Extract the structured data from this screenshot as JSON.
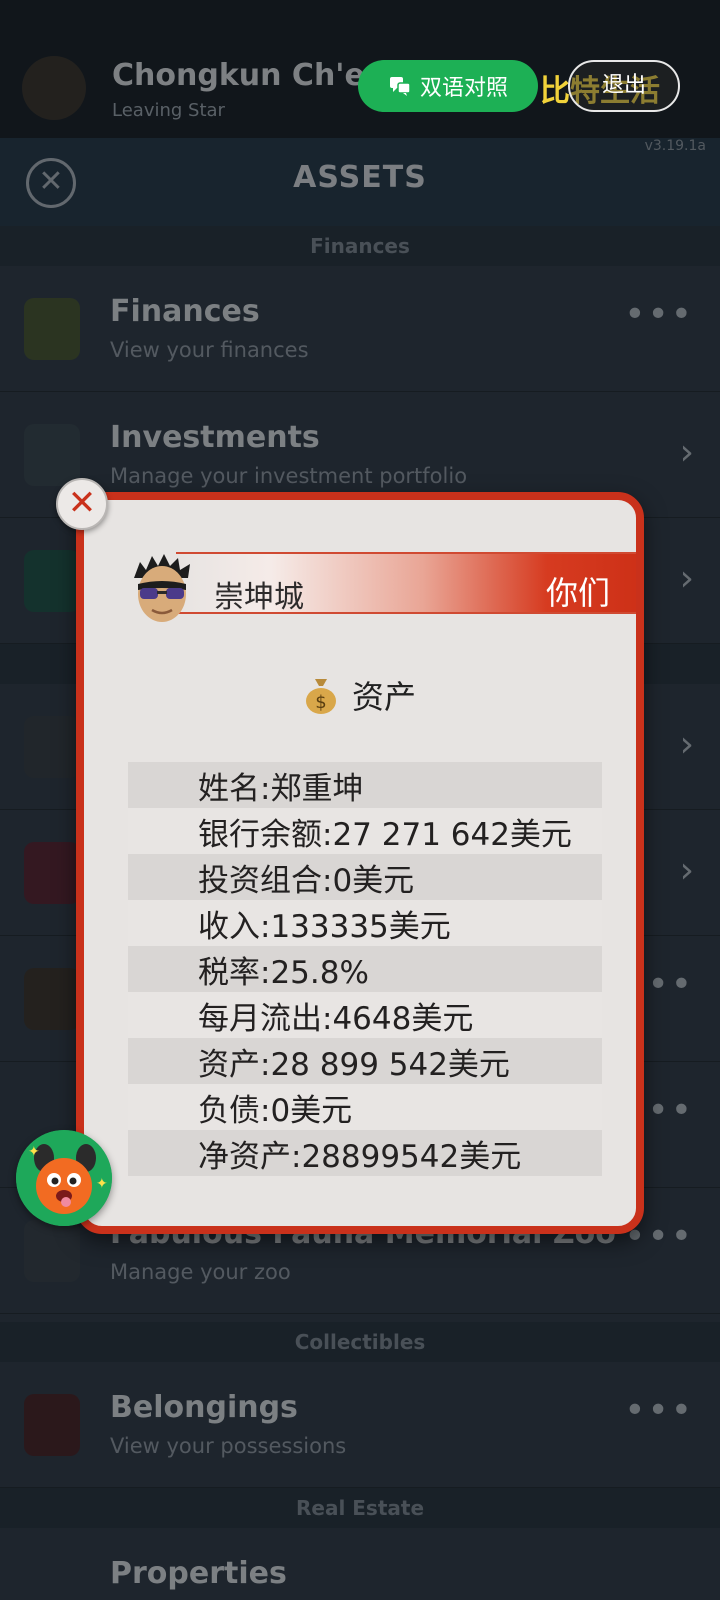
{
  "background": {
    "character_name": "Chongkun Ch'eng",
    "character_sub": "Leaving Star",
    "version": "v3.19.1a",
    "page_title": "ASSETS",
    "sections": {
      "finances": "Finances",
      "collectibles": "Collectibles",
      "real_estate": "Real Estate"
    },
    "rows": [
      {
        "title": "Finances",
        "sub": "View your finances"
      },
      {
        "title": "Investments",
        "sub": "Manage your investment portfolio"
      },
      {
        "title": "Fabulous Fauna Memorial Zoo",
        "sub": "Manage your zoo"
      },
      {
        "title": "Belongings",
        "sub": "View your possessions"
      },
      {
        "title": "Properties",
        "sub": ""
      }
    ]
  },
  "toolbar": {
    "bilingual_label": "双语对照",
    "logo_text": "比特生活",
    "exit_label": "退出"
  },
  "popup": {
    "name": "崇坤城",
    "you_label": "你们",
    "section_label": "资产",
    "stats": [
      "姓名:郑重坤",
      "银行余额:27 271 642美元",
      "投资组合:0美元",
      "收入:133335美元",
      "税率:25.8%",
      "每月流出:4648美元",
      "资产:28 899 542美元",
      "负债:0美元",
      "净资产:28899542美元"
    ]
  },
  "colors": {
    "accent_red": "#c9311b",
    "green_button": "#1db055",
    "logo_yellow": "#f1d23a"
  }
}
